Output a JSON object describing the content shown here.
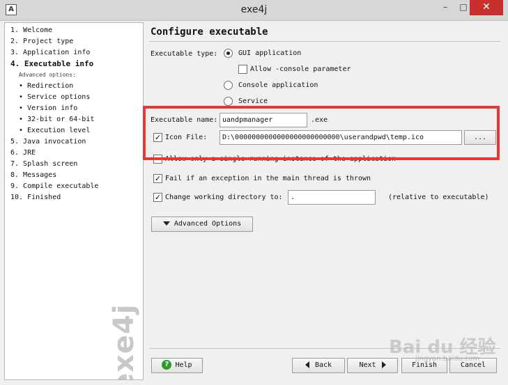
{
  "window": {
    "title": "exe4j",
    "minimize_label": "–",
    "maximize_label": "□",
    "close_label": "✕",
    "app_icon_glyph": "A"
  },
  "steps": {
    "items": [
      "1.  Welcome",
      "2.  Project type",
      "3.  Application info",
      "4.  Executable info",
      "Advanced options:",
      "• Redirection",
      "• Service options",
      "• Version info",
      "• 32-bit or 64-bit",
      "• Execution level",
      "5.  Java invocation",
      "6.  JRE",
      "7.  Splash screen",
      "8.  Messages",
      "9.  Compile executable",
      "10.  Finished"
    ],
    "current_index": 3,
    "logo_text": "exe4j"
  },
  "page": {
    "title": "Configure executable",
    "exec_type_label": "Executable type:",
    "gui_option": "GUI application",
    "allow_console_label": "Allow -console parameter",
    "console_option": "Console application",
    "service_option": "Service",
    "selected_type": "gui",
    "exec_name_label": "Executable name:",
    "exec_name_value": "uandpmanager",
    "exe_suffix": ".exe",
    "icon_file_label": "Icon File:",
    "icon_file_value": "D:\\0000000000000000000000000\\userandpwd\\temp.ico",
    "browse_label": "...",
    "allow_single_label": "Allow only a single running instance of the application",
    "fail_exception_label": "Fail if an exception in the main thread is thrown",
    "change_dir_label": "Change working directory to:",
    "working_dir_value": ".",
    "relative_note": "(relative to executable)",
    "advanced_options_label": "Advanced Options"
  },
  "checkboxes": {
    "allow_console": false,
    "icon_file": true,
    "allow_single": false,
    "fail_exception": true,
    "change_dir": true
  },
  "footer": {
    "help_label": "Help",
    "back_label": "Back",
    "next_label": "Next",
    "finish_label": "Finish",
    "cancel_label": "Cancel"
  },
  "watermark": {
    "text": "Bai du 经验",
    "sub": "jingyan.baidu.com"
  },
  "colors": {
    "highlight": "#e53935",
    "close_button": "#c7302c",
    "help_icon": "#2e9b2e"
  },
  "icons": {
    "help": "help-icon",
    "back": "arrow-left-icon",
    "next": "arrow-right-icon",
    "advanced": "triangle-down-icon"
  }
}
